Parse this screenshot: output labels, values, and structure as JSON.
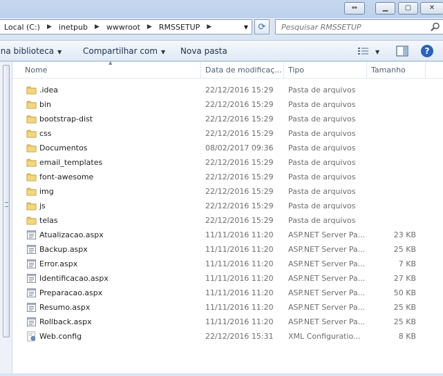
{
  "window": {
    "buttons": {
      "restore": "⇔",
      "minimize": "▁",
      "maximize": "▢",
      "close": "✕"
    }
  },
  "address": {
    "crumbs": [
      "Local (C:)",
      "inetpub",
      "wwwroot",
      "RMSSETUP"
    ],
    "search_placeholder": "Pesquisar RMSSETUP"
  },
  "toolbar": {
    "include_label": "r na biblioteca",
    "share_label": "Compartilhar com",
    "new_folder_label": "Nova pasta",
    "help_label": "?"
  },
  "columns": {
    "name": "Nome",
    "date": "Data de modificaç...",
    "type": "Tipo",
    "size": "Tamanho"
  },
  "files": [
    {
      "name": ".idea",
      "date": "22/12/2016 15:29",
      "type": "Pasta de arquivos",
      "size": "",
      "icon": "folder-icon"
    },
    {
      "name": "bin",
      "date": "22/12/2016 15:29",
      "type": "Pasta de arquivos",
      "size": "",
      "icon": "folder-icon"
    },
    {
      "name": "bootstrap-dist",
      "date": "22/12/2016 15:29",
      "type": "Pasta de arquivos",
      "size": "",
      "icon": "folder-icon"
    },
    {
      "name": "css",
      "date": "22/12/2016 15:29",
      "type": "Pasta de arquivos",
      "size": "",
      "icon": "folder-icon"
    },
    {
      "name": "Documentos",
      "date": "08/02/2017 09:36",
      "type": "Pasta de arquivos",
      "size": "",
      "icon": "folder-icon"
    },
    {
      "name": "email_templates",
      "date": "22/12/2016 15:29",
      "type": "Pasta de arquivos",
      "size": "",
      "icon": "folder-icon"
    },
    {
      "name": "font-awesome",
      "date": "22/12/2016 15:29",
      "type": "Pasta de arquivos",
      "size": "",
      "icon": "folder-icon"
    },
    {
      "name": "img",
      "date": "22/12/2016 15:29",
      "type": "Pasta de arquivos",
      "size": "",
      "icon": "folder-icon"
    },
    {
      "name": "js",
      "date": "22/12/2016 15:29",
      "type": "Pasta de arquivos",
      "size": "",
      "icon": "folder-icon"
    },
    {
      "name": "telas",
      "date": "22/12/2016 15:29",
      "type": "Pasta de arquivos",
      "size": "",
      "icon": "folder-icon"
    },
    {
      "name": "Atualizacao.aspx",
      "date": "11/11/2016 11:20",
      "type": "ASP.NET Server Pa...",
      "size": "23 KB",
      "icon": "aspx-file-icon"
    },
    {
      "name": "Backup.aspx",
      "date": "11/11/2016 11:20",
      "type": "ASP.NET Server Pa...",
      "size": "25 KB",
      "icon": "aspx-file-icon"
    },
    {
      "name": "Error.aspx",
      "date": "11/11/2016 11:20",
      "type": "ASP.NET Server Pa...",
      "size": "7 KB",
      "icon": "aspx-file-icon"
    },
    {
      "name": "Identificacao.aspx",
      "date": "11/11/2016 11:20",
      "type": "ASP.NET Server Pa...",
      "size": "27 KB",
      "icon": "aspx-file-icon"
    },
    {
      "name": "Preparacao.aspx",
      "date": "11/11/2016 11:20",
      "type": "ASP.NET Server Pa...",
      "size": "50 KB",
      "icon": "aspx-file-icon"
    },
    {
      "name": "Resumo.aspx",
      "date": "11/11/2016 11:20",
      "type": "ASP.NET Server Pa...",
      "size": "25 KB",
      "icon": "aspx-file-icon"
    },
    {
      "name": "Rollback.aspx",
      "date": "11/11/2016 11:20",
      "type": "ASP.NET Server Pa...",
      "size": "25 KB",
      "icon": "aspx-file-icon"
    },
    {
      "name": "Web.config",
      "date": "22/12/2016 15:31",
      "type": "XML Configuratio...",
      "size": "8 KB",
      "icon": "config-file-icon"
    }
  ]
}
